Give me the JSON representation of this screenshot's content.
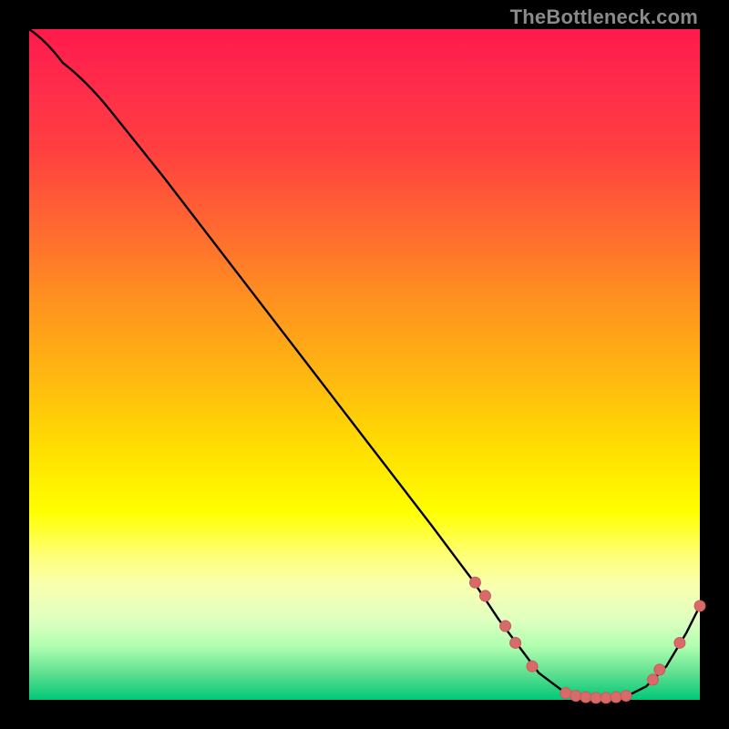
{
  "attribution": "TheBottleneck.com",
  "colors": {
    "line": "#000000",
    "marker_fill": "#d86a6a",
    "marker_stroke": "#c95a5a",
    "plot_background_top": "#ff1a4d",
    "plot_background_bottom": "#00c878",
    "page_background": "#000000"
  },
  "chart_data": {
    "type": "line",
    "title": "",
    "xlabel": "",
    "ylabel": "",
    "xlim": [
      0,
      100
    ],
    "ylim": [
      0,
      100
    ],
    "x": [
      0,
      5,
      12,
      20,
      30,
      40,
      50,
      60,
      66,
      70,
      73,
      76,
      80,
      84,
      88,
      92,
      95,
      98,
      100
    ],
    "y": [
      100,
      95,
      88,
      78,
      65,
      52,
      39,
      26,
      18,
      12,
      8,
      4,
      1,
      0,
      0,
      2,
      5,
      10,
      14
    ],
    "markers": [
      {
        "x": 66.5,
        "y": 17.5
      },
      {
        "x": 68.0,
        "y": 15.5
      },
      {
        "x": 71.0,
        "y": 11.0
      },
      {
        "x": 72.5,
        "y": 8.5
      },
      {
        "x": 75.0,
        "y": 5.0
      },
      {
        "x": 80.0,
        "y": 1.0
      },
      {
        "x": 81.5,
        "y": 0.6
      },
      {
        "x": 83.0,
        "y": 0.4
      },
      {
        "x": 84.5,
        "y": 0.3
      },
      {
        "x": 86.0,
        "y": 0.3
      },
      {
        "x": 87.5,
        "y": 0.4
      },
      {
        "x": 89.0,
        "y": 0.6
      },
      {
        "x": 93.0,
        "y": 3.0
      },
      {
        "x": 94.0,
        "y": 4.5
      },
      {
        "x": 97.0,
        "y": 8.5
      },
      {
        "x": 100.0,
        "y": 14.0
      }
    ],
    "marker_radius": 6
  }
}
